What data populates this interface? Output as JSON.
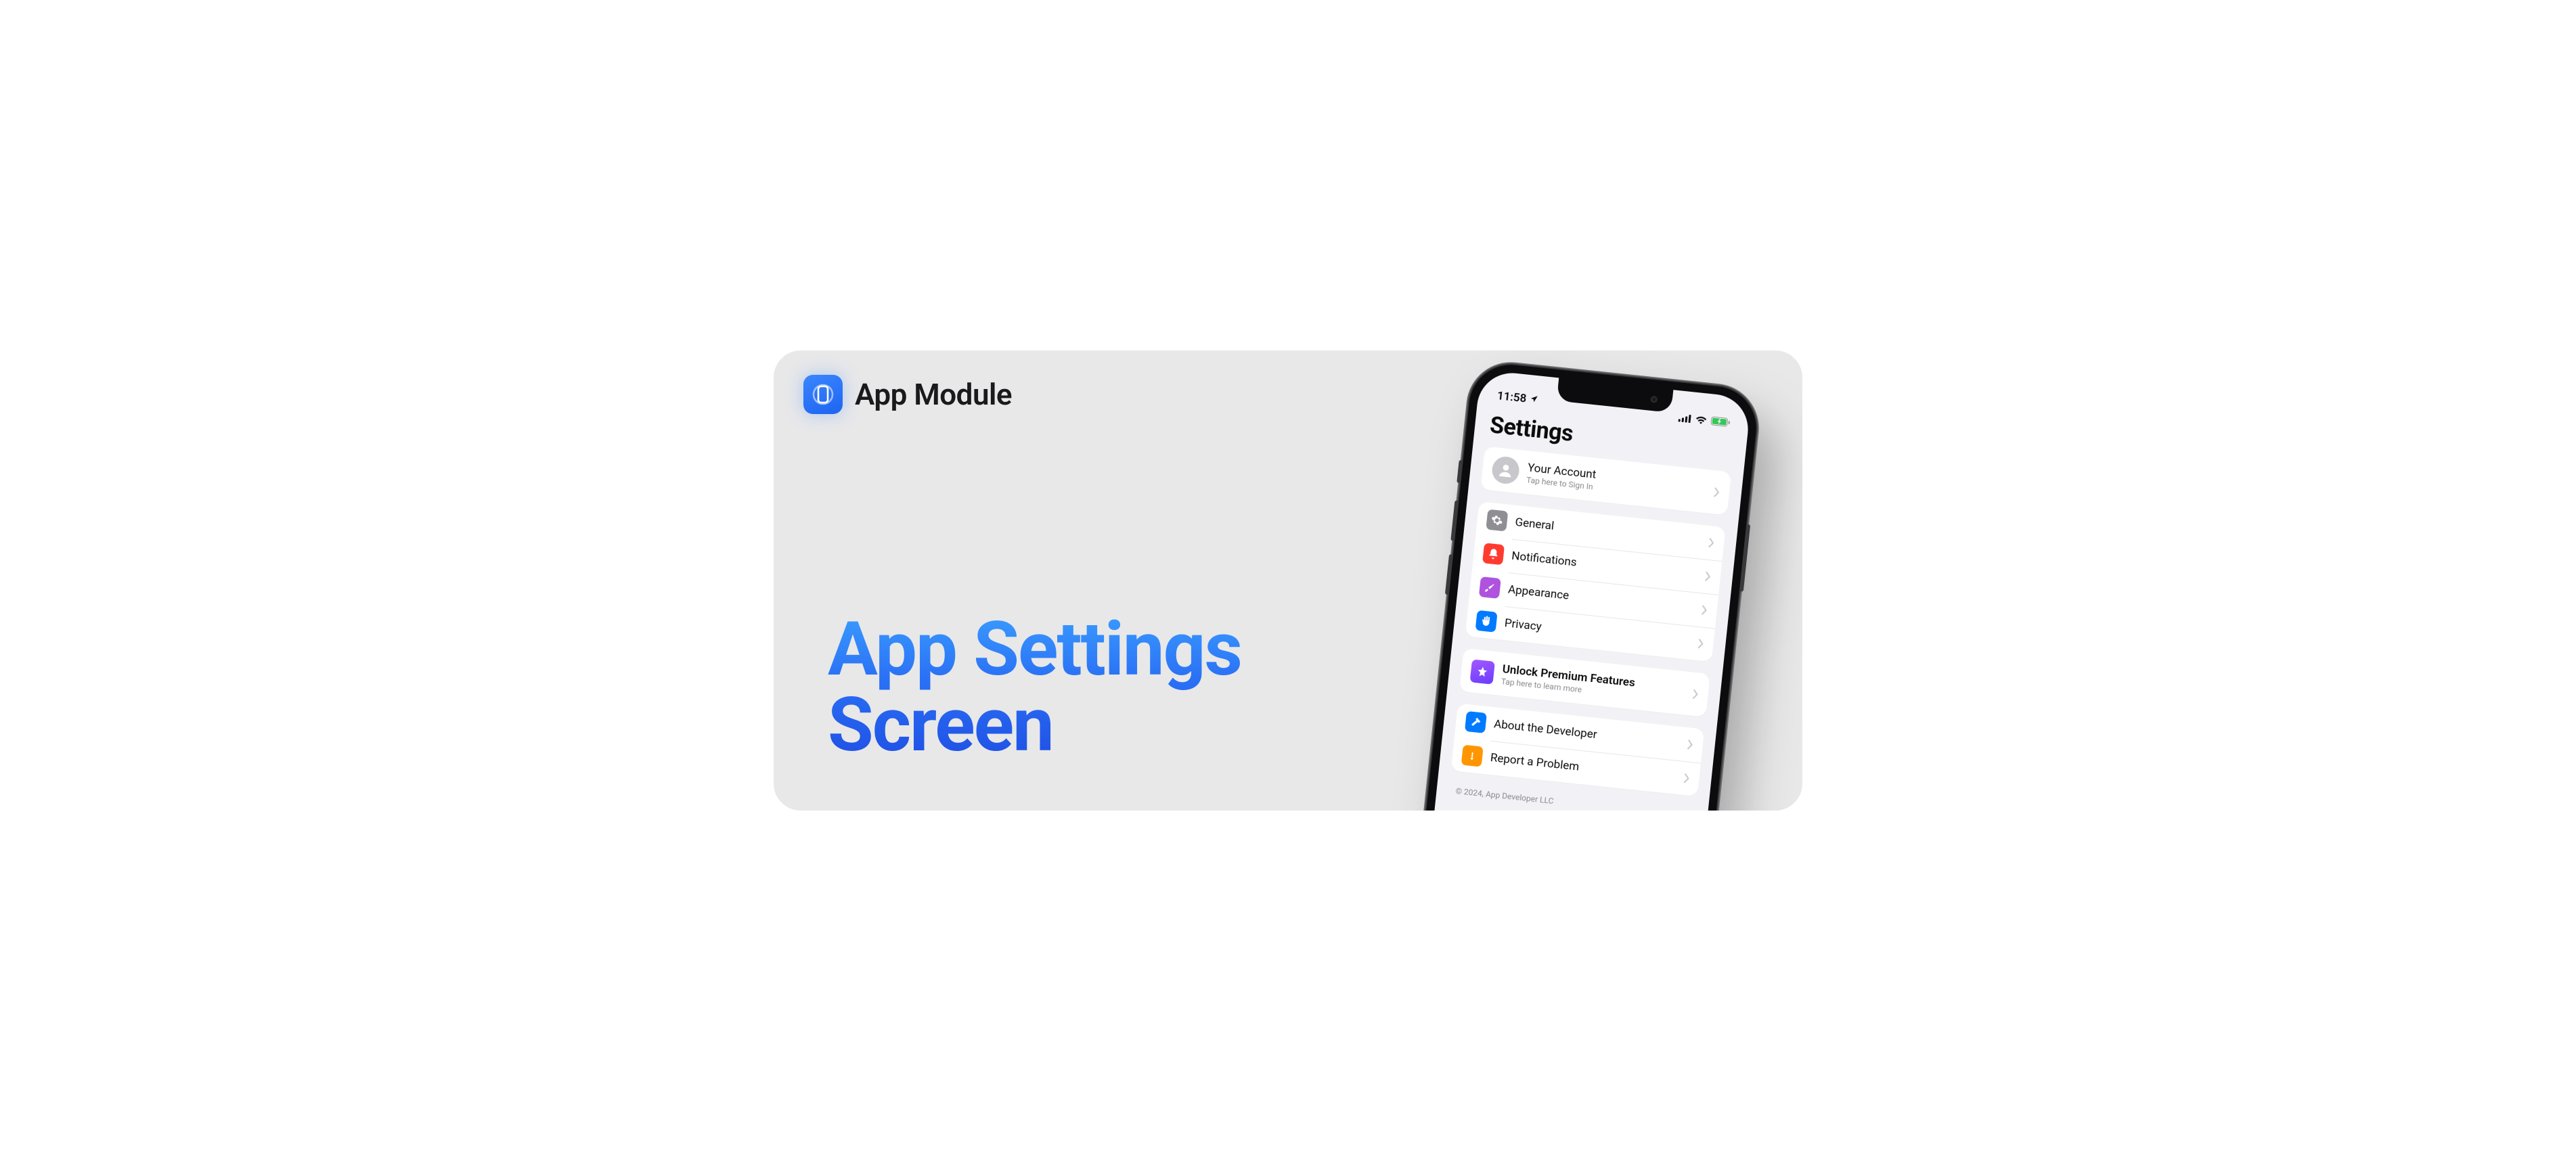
{
  "brand": {
    "label": "App Module"
  },
  "hero": {
    "title_line1": "App Settings",
    "title_line2": "Screen"
  },
  "phone": {
    "status": {
      "time": "11:58"
    },
    "page_title": "Settings",
    "account": {
      "title": "Your Account",
      "subtitle": "Tap here to Sign In"
    },
    "group_main": [
      {
        "icon": "gear",
        "icon_bg": "bg-gray",
        "label": "General"
      },
      {
        "icon": "bell",
        "icon_bg": "bg-red",
        "label": "Notifications"
      },
      {
        "icon": "brush",
        "icon_bg": "bg-purple",
        "label": "Appearance"
      },
      {
        "icon": "hand",
        "icon_bg": "bg-blue",
        "label": "Privacy"
      }
    ],
    "premium": {
      "title": "Unlock Premium Features",
      "subtitle": "Tap here to learn more"
    },
    "group_info": [
      {
        "icon": "hammer",
        "icon_bg": "bg-blue",
        "label": "About the Developer"
      },
      {
        "icon": "warning",
        "icon_bg": "bg-orange",
        "label": "Report a Problem"
      }
    ],
    "footer": "© 2024, App Developer LLC"
  }
}
